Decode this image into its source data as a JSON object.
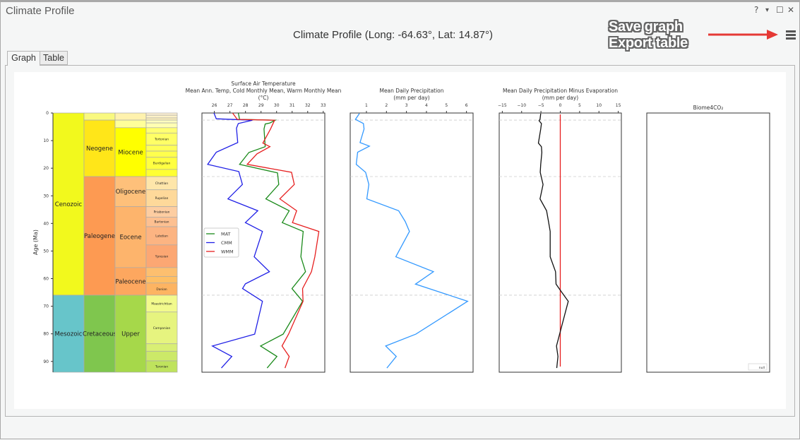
{
  "window": {
    "title": "Climate Profile",
    "controls": {
      "help": "?",
      "menu": "▾",
      "maximize": "☐",
      "close": "✕"
    }
  },
  "header": {
    "title": "Climate Profile (Long: -64.63°, Lat: 14.87°)"
  },
  "tabs": [
    {
      "label": "Graph",
      "active": true
    },
    {
      "label": "Table",
      "active": false
    }
  ],
  "annotation": {
    "lines": [
      "Save graph",
      "Export table"
    ],
    "arrow_color": "#e53935",
    "menu_icon": "hamburger-menu-icon"
  },
  "chart_data": [
    {
      "type": "table",
      "ylabel": "Age (Ma)",
      "ylim": [
        93.9,
        0
      ],
      "yticks": [
        0,
        10,
        20,
        30,
        40,
        50,
        60,
        70,
        80,
        90
      ],
      "columns": {
        "era": [
          {
            "name": "Cenozoic",
            "from": 0,
            "to": 66,
            "color": "#F2F91D"
          },
          {
            "name": "Mesozoic",
            "from": 66,
            "to": 93.9,
            "color": "#67C5CA"
          }
        ],
        "period": [
          {
            "name": "",
            "from": 0,
            "to": 2.58,
            "color": "#F9F97F"
          },
          {
            "name": "Neogene",
            "from": 2.58,
            "to": 23.03,
            "color": "#FFE619"
          },
          {
            "name": "Paleogene",
            "from": 23.03,
            "to": 66,
            "color": "#FD9A52"
          },
          {
            "name": "Cretaceous",
            "from": 66,
            "to": 93.9,
            "color": "#7FC64E"
          }
        ],
        "epoch": [
          {
            "name": "",
            "from": 0,
            "to": 2.58,
            "color": "#FFF2AE"
          },
          {
            "name": "",
            "from": 2.58,
            "to": 5.33,
            "color": "#FFFF99"
          },
          {
            "name": "Miocene",
            "from": 5.33,
            "to": 23.03,
            "color": "#FFFF00"
          },
          {
            "name": "Oligocene",
            "from": 23.03,
            "to": 33.9,
            "color": "#FEC07A"
          },
          {
            "name": "Eocene",
            "from": 33.9,
            "to": 56,
            "color": "#FDB46C"
          },
          {
            "name": "Paleocene",
            "from": 56,
            "to": 66,
            "color": "#FDA75F"
          },
          {
            "name": "Upper",
            "from": 66,
            "to": 93.9,
            "color": "#A6D84A"
          }
        ],
        "stage": [
          {
            "name": "",
            "from": 0,
            "to": 0.8,
            "color": "#FFF2D3"
          },
          {
            "name": "",
            "from": 0.8,
            "to": 1.8,
            "color": "#FFF2C7"
          },
          {
            "name": "",
            "from": 1.8,
            "to": 2.58,
            "color": "#FFF2BA"
          },
          {
            "name": "",
            "from": 2.58,
            "to": 3.6,
            "color": "#FFFFBF"
          },
          {
            "name": "",
            "from": 3.6,
            "to": 5.33,
            "color": "#FFFFB3"
          },
          {
            "name": "",
            "from": 5.33,
            "to": 7.25,
            "color": "#FFFF73"
          },
          {
            "name": "Tortonian",
            "from": 7.25,
            "to": 11.63,
            "color": "#FFFF66"
          },
          {
            "name": "",
            "from": 11.63,
            "to": 13.82,
            "color": "#FFFF59"
          },
          {
            "name": "",
            "from": 13.82,
            "to": 15.97,
            "color": "#FFFF4D"
          },
          {
            "name": "Burdigalian",
            "from": 15.97,
            "to": 20.44,
            "color": "#FFFF41"
          },
          {
            "name": "",
            "from": 20.44,
            "to": 23.03,
            "color": "#FFFF33"
          },
          {
            "name": "Chattian",
            "from": 23.03,
            "to": 27.82,
            "color": "#FEE6AA"
          },
          {
            "name": "Rupelian",
            "from": 27.82,
            "to": 33.9,
            "color": "#FED99A"
          },
          {
            "name": "Priabonian",
            "from": 33.9,
            "to": 37.71,
            "color": "#FDCDA1"
          },
          {
            "name": "Bartonian",
            "from": 37.71,
            "to": 41.2,
            "color": "#FDC091"
          },
          {
            "name": "Lutetian",
            "from": 41.2,
            "to": 47.8,
            "color": "#FCB482"
          },
          {
            "name": "Ypresian",
            "from": 47.8,
            "to": 56,
            "color": "#FCA773"
          },
          {
            "name": "",
            "from": 56,
            "to": 59.2,
            "color": "#FDBF6F"
          },
          {
            "name": "",
            "from": 59.2,
            "to": 61.6,
            "color": "#FEBF65"
          },
          {
            "name": "Danian",
            "from": 61.6,
            "to": 66,
            "color": "#FDB462"
          },
          {
            "name": "Maastrichtian",
            "from": 66,
            "to": 72.1,
            "color": "#F2FA8C"
          },
          {
            "name": "Campanian",
            "from": 72.1,
            "to": 83.6,
            "color": "#E6F47F"
          },
          {
            "name": "",
            "from": 83.6,
            "to": 86.3,
            "color": "#D9EF74"
          },
          {
            "name": "",
            "from": 86.3,
            "to": 89.8,
            "color": "#CCE968"
          },
          {
            "name": "Turonian",
            "from": 89.8,
            "to": 93.9,
            "color": "#BFE35D"
          }
        ]
      }
    },
    {
      "type": "line",
      "title": [
        "Surface Air Temperature",
        "Mean Ann. Temp, Cold Monthly Mean, Warm Monthly Mean",
        "(°C)"
      ],
      "xlim": [
        25.2,
        33.1
      ],
      "xticks": [
        26,
        27,
        28,
        29,
        30,
        31,
        32,
        33
      ],
      "ylim": [
        93.9,
        0
      ],
      "boundaries": [
        2.58,
        23.03,
        66
      ],
      "legend": "center-left",
      "series": [
        {
          "name": "MAT",
          "color": "#1a8a1a",
          "points": [
            [
              0,
              27.54
            ],
            [
              2.3,
              27.62
            ],
            [
              2.6,
              29.91
            ],
            [
              3.6,
              29.57
            ],
            [
              4.0,
              29.27
            ],
            [
              5.8,
              29.19
            ],
            [
              12.2,
              29.27
            ],
            [
              14.3,
              28.22
            ],
            [
              18.6,
              27.62
            ],
            [
              21.7,
              30.06
            ],
            [
              25.9,
              30.14
            ],
            [
              31.1,
              29.31
            ],
            [
              35.4,
              30.81
            ],
            [
              39.7,
              30.36
            ],
            [
              42.9,
              31.71
            ],
            [
              52.1,
              31.56
            ],
            [
              57.5,
              31.86
            ],
            [
              63.6,
              30.99
            ],
            [
              68.2,
              31.67
            ],
            [
              80.1,
              30.42
            ],
            [
              84.4,
              28.97
            ],
            [
              88.2,
              30.02
            ],
            [
              92.4,
              29.39
            ]
          ]
        },
        {
          "name": "CMM",
          "color": "#1f1fe6",
          "points": [
            [
              0,
              25.97
            ],
            [
              2.1,
              26.12
            ],
            [
              2.6,
              28.44
            ],
            [
              3.8,
              27.54
            ],
            [
              5.5,
              27.42
            ],
            [
              10.7,
              27.5
            ],
            [
              14.2,
              26.12
            ],
            [
              18.6,
              25.57
            ],
            [
              21.2,
              27.57
            ],
            [
              25.9,
              27.8
            ],
            [
              31.1,
              26.87
            ],
            [
              35.4,
              28.79
            ],
            [
              39.7,
              27.99
            ],
            [
              42.9,
              29.09
            ],
            [
              52.1,
              28.56
            ],
            [
              57.5,
              29.54
            ],
            [
              61.9,
              27.99
            ],
            [
              63.6,
              27.81
            ],
            [
              68.2,
              29.09
            ],
            [
              80.1,
              28.59
            ],
            [
              84.4,
              25.87
            ],
            [
              88.2,
              27.12
            ],
            [
              92.4,
              26.45
            ]
          ]
        },
        {
          "name": "WMM",
          "color": "#e61f1f",
          "points": [
            [
              0,
              27.17
            ],
            [
              2.3,
              27.47
            ],
            [
              2.6,
              29.87
            ],
            [
              5.8,
              29.61
            ],
            [
              10.9,
              29.12
            ],
            [
              12.2,
              29.57
            ],
            [
              14.8,
              28.74
            ],
            [
              18.6,
              28.11
            ],
            [
              21.5,
              30.96
            ],
            [
              25.9,
              31.14
            ],
            [
              31.1,
              30.21
            ],
            [
              35.4,
              31.29
            ],
            [
              39.7,
              31.02
            ],
            [
              42.9,
              32.72
            ],
            [
              52.1,
              32.46
            ],
            [
              57.5,
              32.24
            ],
            [
              63.6,
              31.67
            ],
            [
              68.2,
              31.7
            ],
            [
              80.1,
              30.77
            ],
            [
              84.4,
              30.35
            ],
            [
              88.2,
              30.81
            ],
            [
              92.4,
              30.54
            ]
          ]
        }
      ]
    },
    {
      "type": "line",
      "title": [
        "Mean Daily Precipitation",
        "(mm per day)"
      ],
      "xlim": [
        0.19,
        6.33
      ],
      "xticks": [
        1,
        2,
        3,
        4,
        5,
        6
      ],
      "ylim": [
        93.9,
        0
      ],
      "boundaries": [
        2.58,
        23.03,
        66
      ],
      "series": [
        {
          "color": "#3399ff",
          "points": [
            [
              0.2,
              0.65
            ],
            [
              2.3,
              0.45
            ],
            [
              3.8,
              0.85
            ],
            [
              5.8,
              0.88
            ],
            [
              10.7,
              0.68
            ],
            [
              12.0,
              1.15
            ],
            [
              14.2,
              0.56
            ],
            [
              18.6,
              0.49
            ],
            [
              21.5,
              0.96
            ],
            [
              25.9,
              1.12
            ],
            [
              31.1,
              1.02
            ],
            [
              35.4,
              2.61
            ],
            [
              39.3,
              2.94
            ],
            [
              42.9,
              3.15
            ],
            [
              52.1,
              2.47
            ],
            [
              57.5,
              4.35
            ],
            [
              62.0,
              3.45
            ],
            [
              68.2,
              6.06
            ],
            [
              80.1,
              3.47
            ],
            [
              84.4,
              1.96
            ],
            [
              88.2,
              2.49
            ],
            [
              92.4,
              2.02
            ]
          ]
        }
      ]
    },
    {
      "type": "line",
      "title": [
        "Mean Daily Precipitation Minus Evaporation",
        "(mm per day)"
      ],
      "xlim": [
        -15.8,
        15.8
      ],
      "xticks": [
        -15,
        -10,
        -5,
        0,
        5,
        10,
        15
      ],
      "ylim": [
        93.9,
        0
      ],
      "boundaries": [
        2.58,
        23.03,
        66
      ],
      "zero_line_color": "#e61f1f",
      "series": [
        {
          "color": "#111111",
          "points": [
            [
              0.2,
              -5.06
            ],
            [
              2.3,
              -5.24
            ],
            [
              2.8,
              -5.49
            ],
            [
              3.8,
              -4.88
            ],
            [
              5.8,
              -5.06
            ],
            [
              10.9,
              -5.67
            ],
            [
              12.2,
              -4.88
            ],
            [
              14.3,
              -4.76
            ],
            [
              18.6,
              -5.06
            ],
            [
              21.5,
              -5.18
            ],
            [
              25.9,
              -4.45
            ],
            [
              31.1,
              -5.24
            ],
            [
              35.4,
              -3.54
            ],
            [
              39.3,
              -3.05
            ],
            [
              42.9,
              -2.62
            ],
            [
              52.1,
              -2.62
            ],
            [
              57.5,
              -1.22
            ],
            [
              62.0,
              -1.1
            ],
            [
              64.2,
              0
            ],
            [
              68.2,
              2.07
            ],
            [
              79.2,
              0
            ],
            [
              84.4,
              -0.98
            ],
            [
              88.2,
              -0.61
            ],
            [
              92.4,
              -0.91
            ]
          ]
        }
      ]
    },
    {
      "type": "line",
      "title": [
        "Biome4CO₂"
      ],
      "ylim": [
        93.9,
        0
      ],
      "legend_entries": [
        "null"
      ],
      "legend": "bottom-right",
      "series": []
    }
  ]
}
